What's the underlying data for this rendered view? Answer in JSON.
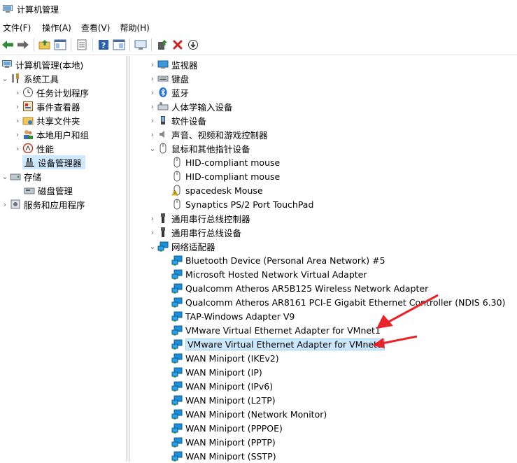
{
  "window": {
    "title": "计算机管理"
  },
  "menu": [
    "文件(F)",
    "操作(A)",
    "查看(V)",
    "帮助(H)"
  ],
  "toolbar_icons": [
    "back-icon",
    "forward-icon",
    "up-folder-icon",
    "show-hide-tree-icon",
    "properties-icon",
    "help-icon",
    "view-icon",
    "monitor-icon",
    "update-driver-icon",
    "uninstall-icon",
    "disable-icon"
  ],
  "tree": {
    "root": "计算机管理(本地)",
    "system_tools": "系统工具",
    "task_scheduler": "任务计划程序",
    "event_viewer": "事件查看器",
    "shared_folders": "共享文件夹",
    "local_users": "本地用户和组",
    "performance": "性能",
    "device_manager": "设备管理器",
    "storage": "存储",
    "disk_management": "磁盘管理",
    "services_apps": "服务和应用程序"
  },
  "devices": {
    "monitors": "监视器",
    "keyboards": "键盘",
    "bluetooth": "蓝牙",
    "hid": "人体学输入设备",
    "software_devices": "软件设备",
    "sound": "声音、视频和游戏控制器",
    "mice": "鼠标和其他指针设备",
    "mice_children": [
      "HID-compliant mouse",
      "HID-compliant mouse",
      "spacedesk Mouse",
      "Synaptics PS/2 Port TouchPad"
    ],
    "usb_controllers": "通用串行总线控制器",
    "usb_devices": "通用串行总线设备",
    "network_adapters": "网络适配器",
    "network_children": [
      "Bluetooth Device (Personal Area Network) #5",
      "Microsoft Hosted Network Virtual Adapter",
      "Qualcomm Atheros AR5B125 Wireless Network Adapter",
      "Qualcomm Atheros AR8161 PCI-E Gigabit Ethernet Controller (NDIS 6.30)",
      "TAP-Windows Adapter V9",
      "VMware Virtual Ethernet Adapter for VMnet1",
      "VMware Virtual Ethernet Adapter for VMnet8",
      "WAN Miniport (IKEv2)",
      "WAN Miniport (IP)",
      "WAN Miniport (IPv6)",
      "WAN Miniport (L2TP)",
      "WAN Miniport (Network Monitor)",
      "WAN Miniport (PPPOE)",
      "WAN Miniport (PPTP)",
      "WAN Miniport (SSTP)"
    ],
    "selected_adapter": "VMware Virtual Ethernet Adapter for VMnet8"
  },
  "colors": {
    "selection": "#cce8ff",
    "annotation_arrow": "#e8242a",
    "net_icon": "#1e8fd6"
  }
}
